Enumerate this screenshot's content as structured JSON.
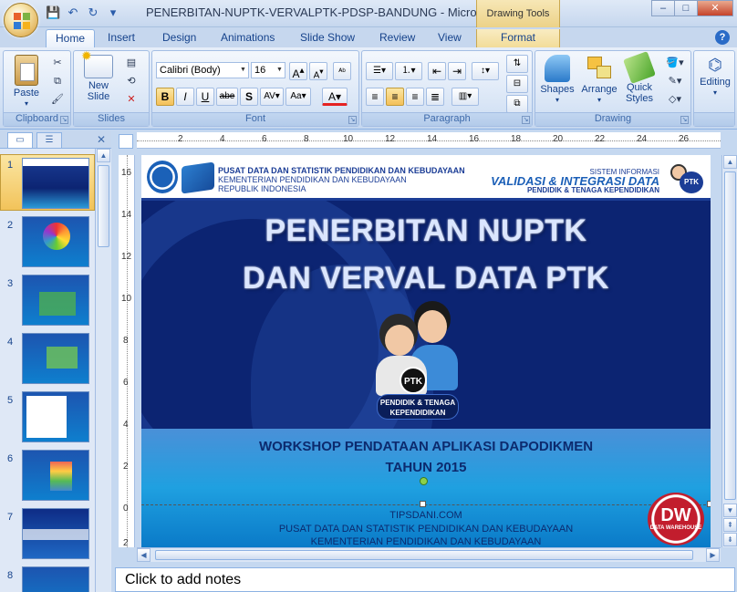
{
  "window": {
    "title": "PENERBITAN-NUPTK-VERVALPTK-PDSP-BANDUNG - Microsoft...",
    "context_tools": "Drawing Tools",
    "controls": {
      "minimize": "–",
      "maximize": "□",
      "close": "✕"
    }
  },
  "qat": {
    "save_icon": "floppy-icon",
    "undo_icon": "undo-icon",
    "redo_icon": "redo-icon",
    "customize": "▾"
  },
  "tabs": [
    {
      "label": "Home",
      "active": true
    },
    {
      "label": "Insert"
    },
    {
      "label": "Design"
    },
    {
      "label": "Animations"
    },
    {
      "label": "Slide Show"
    },
    {
      "label": "Review"
    },
    {
      "label": "View"
    },
    {
      "label": "Format",
      "contextual": true
    }
  ],
  "ribbon": {
    "clipboard": {
      "label": "Clipboard",
      "paste": "Paste"
    },
    "slides": {
      "label": "Slides",
      "new_slide_line1": "New",
      "new_slide_line2": "Slide"
    },
    "font": {
      "label": "Font",
      "family": "Calibri (Body)",
      "size": "16"
    },
    "paragraph": {
      "label": "Paragraph"
    },
    "drawing": {
      "label": "Drawing",
      "shapes": "Shapes",
      "arrange": "Arrange",
      "quick_styles_1": "Quick",
      "quick_styles_2": "Styles"
    },
    "editing": {
      "label": "Editing"
    }
  },
  "ruler": {
    "h_ticks": [
      "2",
      "4",
      "6",
      "8",
      "10",
      "12",
      "14",
      "16",
      "18",
      "20",
      "22",
      "24",
      "26"
    ],
    "v_ticks": [
      "16",
      "14",
      "12",
      "10",
      "8",
      "6",
      "4",
      "2",
      "0",
      "2"
    ]
  },
  "thumbnails": [
    {
      "num": "1",
      "selected": true
    },
    {
      "num": "2"
    },
    {
      "num": "3"
    },
    {
      "num": "4"
    },
    {
      "num": "5"
    },
    {
      "num": "6"
    },
    {
      "num": "7"
    },
    {
      "num": "8"
    }
  ],
  "slide": {
    "header": {
      "org_line1": "PUSAT DATA DAN STATISTIK PENDIDIKAN DAN KEBUDAYAAN",
      "org_line2": "KEMENTERIAN PENDIDIKAN DAN KEBUDAYAAN",
      "org_line3": "REPUBLIK INDONESIA",
      "sys_line1": "SISTEM INFORMASI",
      "sys_line2": "VALIDASI & INTEGRASI DATA",
      "sys_line3": "PENDIDIK & TENAGA KEPENDIDIKAN",
      "badge": "PTK"
    },
    "title_line1": "PENERBITAN NUPTK",
    "title_line2": "DAN VERVAL DATA PTK",
    "ptk_circle": "PTK",
    "ptk_label_1": "PENDIDIK & TENAGA",
    "ptk_label_2": "KEPENDIDIKAN",
    "workshop_line1": "WORKSHOP PENDATAAN APLIKASI DAPODIKMEN",
    "workshop_line2": "TAHUN 2015",
    "site": "TIPSDANI.COM",
    "footer_line1": "PUSAT DATA DAN STATISTIK PENDIDIKAN DAN KEBUDAYAAN",
    "footer_line2": "KEMENTERIAN PENDIDIKAN DAN KEBUDAYAAN",
    "dw_logo": "DW",
    "dw_text": "DATA WAREHOUSE"
  },
  "notes": {
    "placeholder": "Click to add notes"
  }
}
